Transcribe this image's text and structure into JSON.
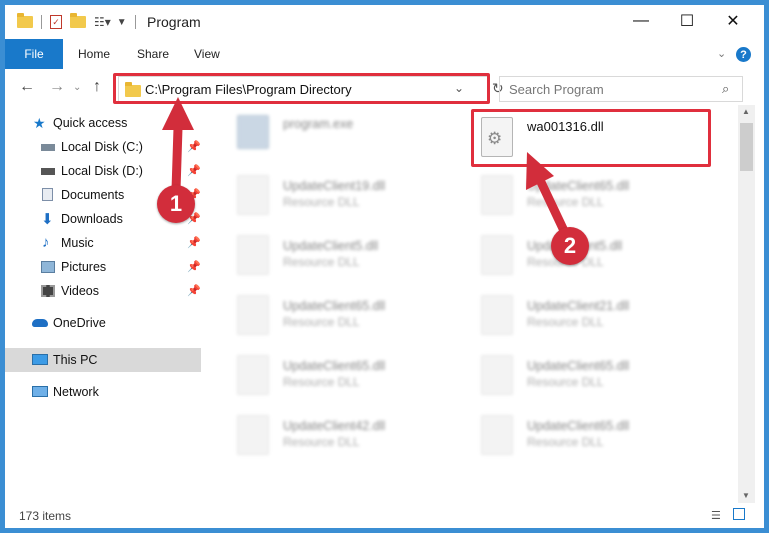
{
  "window": {
    "title": "Program",
    "controls": {
      "minimize": "—",
      "maximize": "☐",
      "close": "✕"
    }
  },
  "ribbon": {
    "file_tab": "File",
    "tabs": [
      "Home",
      "Share",
      "View"
    ],
    "help": "?"
  },
  "nav": {
    "back": "←",
    "forward": "→",
    "up": "↑",
    "address": "C:\\Program Files\\Program Directory",
    "search_placeholder": "Search Program"
  },
  "sidebar": {
    "items": [
      {
        "label": "Quick access",
        "icon": "star-icon",
        "pinned": false
      },
      {
        "label": "Local Disk (C:)",
        "icon": "drive-icon",
        "pinned": true
      },
      {
        "label": "Local Disk (D:)",
        "icon": "drive-icon",
        "pinned": true
      },
      {
        "label": "Documents",
        "icon": "documents-icon",
        "pinned": true
      },
      {
        "label": "Downloads",
        "icon": "download-icon",
        "pinned": true
      },
      {
        "label": "Music",
        "icon": "music-icon",
        "pinned": true
      },
      {
        "label": "Pictures",
        "icon": "pictures-icon",
        "pinned": true
      },
      {
        "label": "Videos",
        "icon": "videos-icon",
        "pinned": true
      },
      {
        "label": "OneDrive",
        "icon": "cloud-icon",
        "pinned": false
      },
      {
        "label": "This PC",
        "icon": "pc-icon",
        "pinned": false
      },
      {
        "label": "Network",
        "icon": "network-icon",
        "pinned": false
      }
    ]
  },
  "files": {
    "left": [
      {
        "name": "program.exe",
        "type": ""
      },
      {
        "name": "UpdateClient19.dll",
        "type": "Resource DLL"
      },
      {
        "name": "UpdateClient5.dll",
        "type": "Resource DLL"
      },
      {
        "name": "UpdateClient65.dll",
        "type": "Resource DLL"
      },
      {
        "name": "UpdateClient65.dll",
        "type": "Resource DLL"
      },
      {
        "name": "UpdateClient42.dll",
        "type": "Resource DLL"
      }
    ],
    "right": [
      {
        "name": "wa001316.dll",
        "type": ""
      },
      {
        "name": "UpdateClient65.dll",
        "type": "Resource DLL"
      },
      {
        "name": "UpdateClient5.dll",
        "type": "Resource DLL"
      },
      {
        "name": "UpdateClient21.dll",
        "type": "Resource DLL"
      },
      {
        "name": "UpdateClient65.dll",
        "type": "Resource DLL"
      },
      {
        "name": "UpdateClient65.dll",
        "type": "Resource DLL"
      }
    ]
  },
  "status": {
    "item_count": "173 items"
  },
  "callouts": {
    "one": "1",
    "two": "2"
  },
  "colors": {
    "highlight": "#e02f3d",
    "accent": "#1979ca",
    "callout": "#d22d3b"
  }
}
